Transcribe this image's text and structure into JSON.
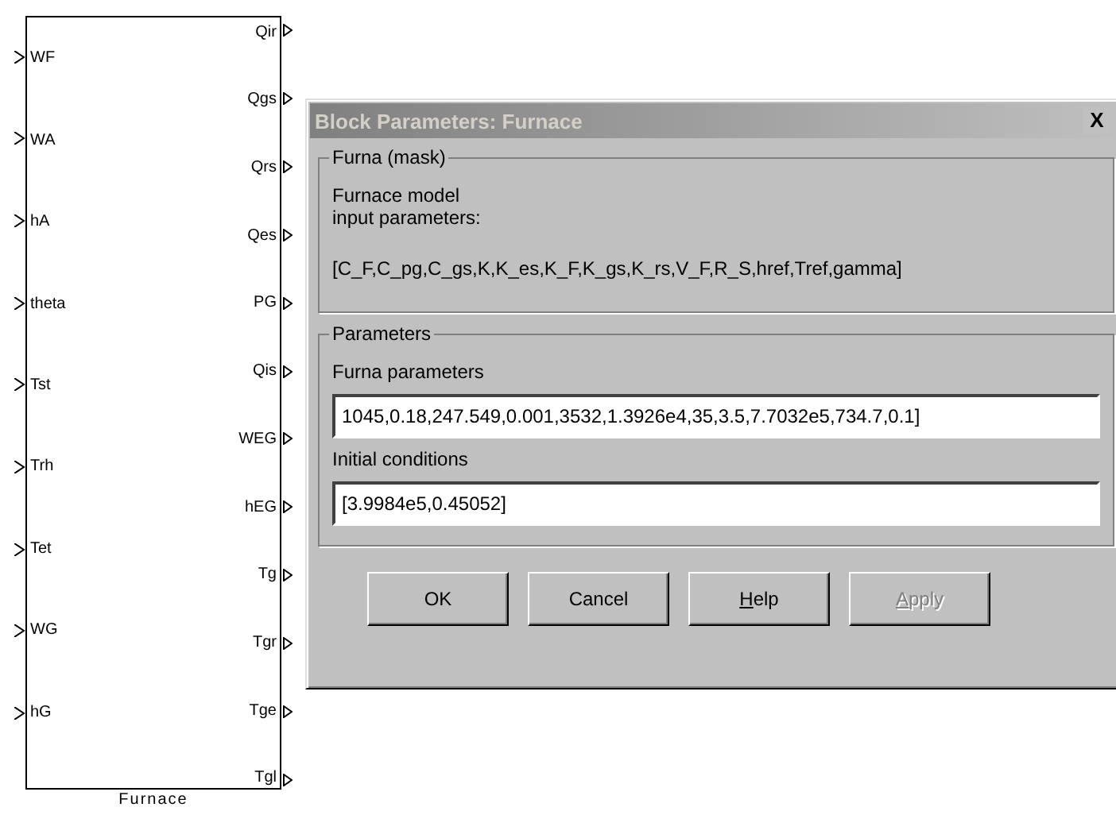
{
  "block": {
    "name": "Furnace",
    "inputs": [
      "WF",
      "WA",
      "hA",
      "theta",
      "Tst",
      "Trh",
      "Tet",
      "WG",
      "hG"
    ],
    "outputs": [
      "Qir",
      "Qgs",
      "Qrs",
      "Qes",
      "PG",
      "Qis",
      "WEG",
      "hEG",
      "Tg",
      "Tgr",
      "Tge",
      "Tgl"
    ]
  },
  "dialog": {
    "title": "Block Parameters: Furnace",
    "active": false,
    "close": "X",
    "mask_group": {
      "title": "Furna (mask)",
      "description": [
        "Furnace model",
        "input parameters:"
      ],
      "parameter_list": "[C_F,C_pg,C_gs,K,K_es,K_F,K_gs,K_rs,V_F,R_S,href,Tref,gamma]"
    },
    "parameters_group": {
      "title": "Parameters",
      "fields": [
        {
          "label": "Furna parameters",
          "value": "1045,0.18,247.549,0.001,3532,1.3926e4,35,3.5,7.7032e5,734.7,0.1]"
        },
        {
          "label": "Initial conditions",
          "value": "[3.9984e5,0.45052]"
        }
      ]
    },
    "buttons": [
      {
        "label": "OK",
        "disabled": false,
        "access_key_underlined": false
      },
      {
        "label": "Cancel",
        "disabled": false,
        "access_key_underlined": false
      },
      {
        "label": "Help",
        "disabled": false,
        "access_key_underlined": true
      },
      {
        "label": "Apply",
        "disabled": true,
        "access_key_underlined": true
      }
    ]
  }
}
